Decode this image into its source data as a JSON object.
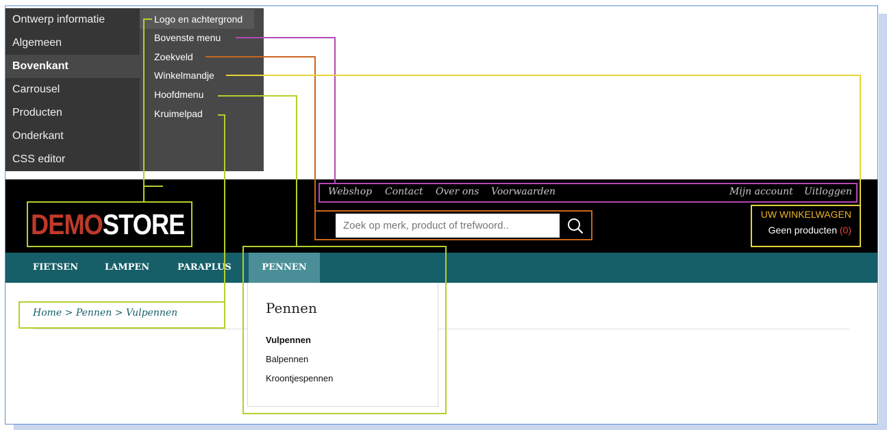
{
  "editor_menu": {
    "items": [
      {
        "label": "Ontwerp informatie"
      },
      {
        "label": "Algemeen"
      },
      {
        "label": "Bovenkant"
      },
      {
        "label": "Carrousel"
      },
      {
        "label": "Producten"
      },
      {
        "label": "Onderkant"
      },
      {
        "label": "CSS editor"
      }
    ],
    "active": "Bovenkant"
  },
  "editor_submenu": {
    "items": [
      {
        "label": "Logo en achtergrond"
      },
      {
        "label": "Bovenste menu"
      },
      {
        "label": "Zoekveld"
      },
      {
        "label": "Winkelmandje"
      },
      {
        "label": "Hoofdmenu"
      },
      {
        "label": "Kruimelpad"
      }
    ]
  },
  "store": {
    "logo_part1": "DEMO",
    "logo_part2": "STORE",
    "top_menu": {
      "left": [
        "Webshop",
        "Contact",
        "Over ons",
        "Voorwaarden"
      ],
      "right": [
        "Mijn account",
        "Uitloggen"
      ]
    },
    "search": {
      "placeholder": "Zoek op merk, product of trefwoord..",
      "icon": "search-icon"
    },
    "cart": {
      "title": "UW WINKELWAGEN",
      "status": "Geen producten",
      "count": "(0)"
    },
    "main_nav": [
      "FIETSEN",
      "LAMPEN",
      "PARAPLUS",
      "PENNEN"
    ],
    "active_nav": "PENNEN",
    "breadcrumb": {
      "items": [
        "Home",
        "Pennen",
        "Vulpennen"
      ],
      "separator": ">"
    },
    "dropdown": {
      "title": "Pennen",
      "items": [
        "Vulpennen",
        "Balpennen",
        "Kroontjespennen"
      ],
      "active": "Vulpennen"
    }
  },
  "colors": {
    "header_bg": "#000000",
    "nav_bg": "#175f68",
    "nav_active": "#4a8f98",
    "logo_red": "#c0392b",
    "cart_title": "#f0b428",
    "annot_green": "#b5cf2d",
    "annot_purple": "#b548b5",
    "annot_orange": "#c8661e",
    "annot_yellow": "#e6d43a"
  }
}
